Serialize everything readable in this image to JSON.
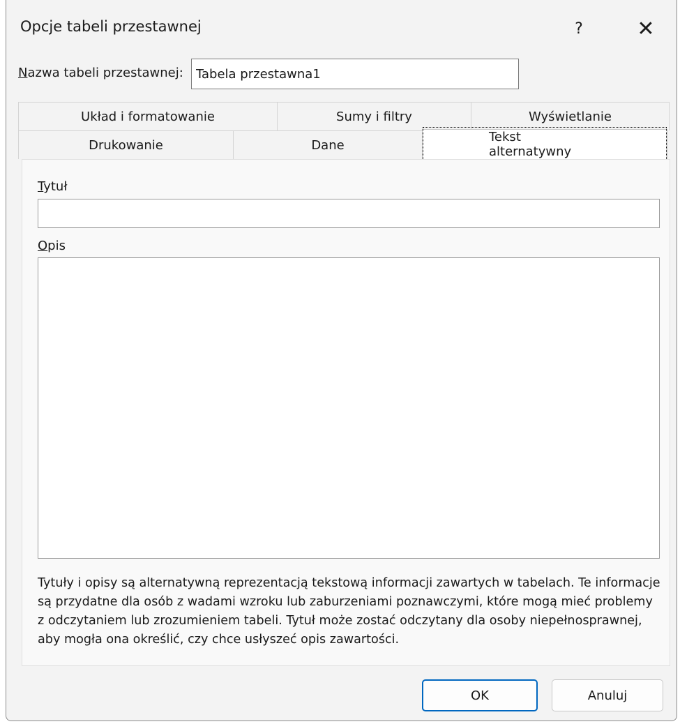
{
  "dialog": {
    "title": "Opcje tabeli przestawnej",
    "help_glyph": "?",
    "close_glyph": "✕"
  },
  "name_field": {
    "label_first": "N",
    "label_rest": "azwa tabeli przestawnej:",
    "value": "Tabela przestawna1"
  },
  "tabs": {
    "row1": [
      "Układ i formatowanie",
      "Sumy i filtry",
      "Wyświetlanie"
    ],
    "row2": [
      "Drukowanie",
      "Dane",
      "Tekst alternatywny"
    ],
    "active": "Tekst alternatywny"
  },
  "alt_text": {
    "title_label_first": "T",
    "title_label_rest": "ytuł",
    "title_value": "",
    "desc_label_first": "O",
    "desc_label_rest": "pis",
    "desc_value": "",
    "info": "Tytuły i opisy są alternatywną reprezentacją tekstową informacji zawartych w tabelach. Te informacje są przydatne dla osób z wadami wzroku lub zaburzeniami poznawczymi, które mogą mieć problemy z odczytaniem lub zrozumieniem tabeli. Tytuł może zostać odczytany dla osoby niepełnosprawnej, aby mogła ona określić, czy chce usłyszeć opis zawartości."
  },
  "buttons": {
    "ok": "OK",
    "cancel": "Anuluj"
  }
}
